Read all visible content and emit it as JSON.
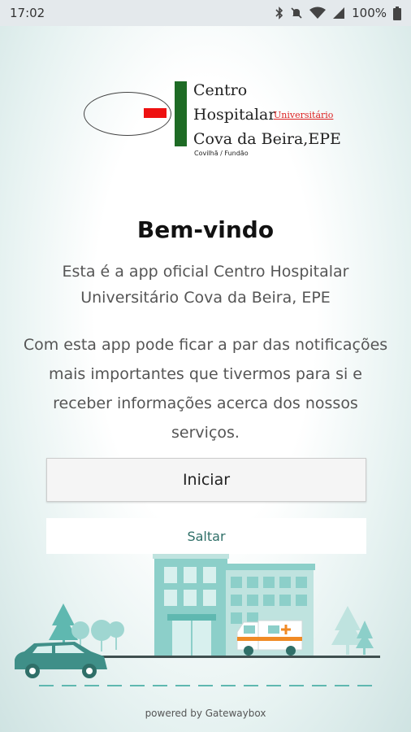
{
  "status_bar": {
    "time": "17:02",
    "battery": "100%",
    "icons": [
      "bluetooth-icon",
      "mute-icon",
      "wifi-icon",
      "signal-icon",
      "battery-icon"
    ]
  },
  "logo": {
    "line1": "Centro",
    "line2": "Hospitalar",
    "line2_small": "Universitário",
    "line3": "Cova da Beira,EPE",
    "line4": "Covilhã / Fundão",
    "colors": {
      "bar": "#1e6b25",
      "accent": "#e11111"
    }
  },
  "welcome": {
    "title": "Bem-vindo",
    "intro_line1": "Esta é a app oficial Centro Hospitalar",
    "intro_line2": "Universitário Cova da Beira, EPE",
    "desc_line1": "Com esta app pode ficar a par das notificações",
    "desc_line2": "mais importantes que tivermos para si e",
    "desc_line3": "receber informações acerca dos nossos",
    "desc_line4": "serviços."
  },
  "actions": {
    "start_label": "Iniciar",
    "skip_label": "Saltar"
  },
  "footer": {
    "powered_by": "powered by Gatewaybox"
  },
  "theme": {
    "teal": "#5fb8b0",
    "dark_teal": "#2f6f68",
    "ambulance_orange": "#f08a24"
  }
}
